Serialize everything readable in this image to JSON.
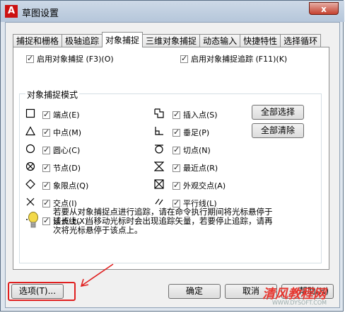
{
  "window": {
    "title": "草图设置",
    "close_label": "x"
  },
  "tabs": [
    "捕捉和栅格",
    "极轴追踪",
    "对象捕捉",
    "三维对象捕捉",
    "动态输入",
    "快捷特性",
    "选择循环"
  ],
  "top_options": {
    "enable_snap": "启用对象捕捉 (F3)(O)",
    "enable_tracking": "启用对象捕捉追踪 (F11)(K)"
  },
  "modes_group": {
    "title": "对象捕捉模式",
    "left": [
      {
        "label": "端点(E)",
        "icon": "endpoint-square-icon",
        "checked": true
      },
      {
        "label": "中点(M)",
        "icon": "midpoint-triangle-icon",
        "checked": true
      },
      {
        "label": "圆心(C)",
        "icon": "center-circle-icon",
        "checked": true
      },
      {
        "label": "节点(D)",
        "icon": "node-icon",
        "checked": true
      },
      {
        "label": "象限点(Q)",
        "icon": "quadrant-diamond-icon",
        "checked": true
      },
      {
        "label": "交点(I)",
        "icon": "intersection-x-icon",
        "checked": true
      },
      {
        "label": "延长线(X)",
        "icon": "extension-icon",
        "checked": true
      }
    ],
    "right": [
      {
        "label": "插入点(S)",
        "icon": "insertion-icon",
        "checked": true
      },
      {
        "label": "垂足(P)",
        "icon": "perpendicular-icon",
        "checked": true
      },
      {
        "label": "切点(N)",
        "icon": "tangent-icon",
        "checked": true
      },
      {
        "label": "最近点(R)",
        "icon": "nearest-icon",
        "checked": true
      },
      {
        "label": "外观交点(A)",
        "icon": "apparent-intersection-icon",
        "checked": true
      },
      {
        "label": "平行线(L)",
        "icon": "parallel-icon",
        "checked": true
      }
    ],
    "select_all": "全部选择",
    "clear_all": "全部清除"
  },
  "info": {
    "line1": "若要从对象捕捉点进行追踪，请在命令执行期间将光标悬停于",
    "line2": "该点上。当移动光标时会出现追踪矢量，若要停止追踪，请再",
    "line3": "次将光标悬停于该点上。"
  },
  "bottom": {
    "options": "选项(T)...",
    "ok": "确定",
    "cancel": "取消",
    "help": "帮助(H)"
  },
  "watermark": {
    "main": "清风教程网",
    "url": "WWW.DYSOFT.COM"
  }
}
